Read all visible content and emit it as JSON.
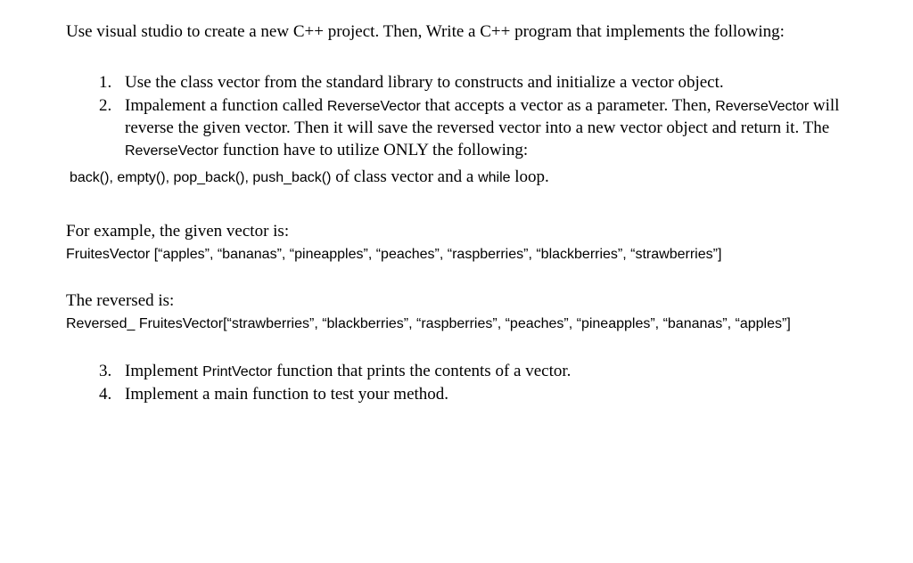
{
  "intro": "Use visual studio to create a new C++ project. Then, Write a C++ program that implements the following:",
  "item1": "Use the class vector from the standard library to constructs and initialize a vector object.",
  "item2_part1": "Impalement a function called ",
  "item2_fn1": "ReverseVector",
  "item2_part2": " that accepts a vector as a parameter. Then, ",
  "item2_fn2": "ReverseVector",
  "item2_part3": " will reverse the given vector. Then it will save the reversed vector into a new vector object and return it. The ",
  "item2_fn3": "ReverseVector",
  "item2_part4": " function have to utilize ONLY the following:",
  "methods": "back(), empty(), pop_back(), push_back()",
  "methods_tail1": "  of class vector and a ",
  "methods_while": "while",
  "methods_tail2": " loop.",
  "example1_heading": "For example, the given vector is:",
  "example1_content": "FruitesVector [“apples”, “bananas”, “pineapples”, “peaches”, “raspberries”, “blackberries”, “strawberries”]",
  "example2_heading": "The reversed is:",
  "example2_content": "Reversed_ FruitesVector[“strawberries”, “blackberries”, “raspberries”, “peaches”, “pineapples”,  “bananas”, “apples”]",
  "item3_part1": "Implement ",
  "item3_fn": "PrintVector",
  "item3_part2": " function that prints the contents of a vector.",
  "item4": "Implement a main function to test your method."
}
